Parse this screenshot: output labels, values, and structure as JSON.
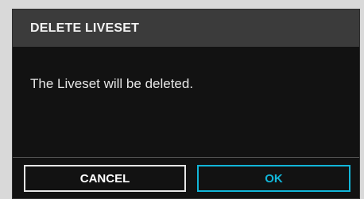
{
  "dialog": {
    "title": "DELETE LIVESET",
    "message": "The Liveset will be deleted.",
    "cancel_label": "CANCEL",
    "ok_label": "OK"
  },
  "colors": {
    "header_bg": "#3b3b3b",
    "body_bg": "#121212",
    "accent": "#11b6d9",
    "text": "#e6e6e6"
  }
}
